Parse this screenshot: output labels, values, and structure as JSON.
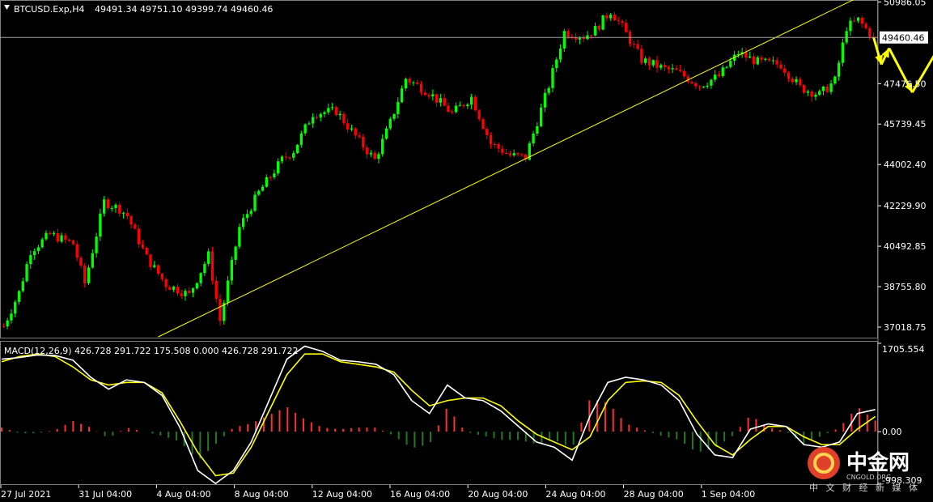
{
  "header": {
    "symbol_label": "BTCUSD.Exp,H4",
    "ohlc_label": "49491.34 49751.10 49399.74 49460.46"
  },
  "current_price_label": "49460.46",
  "macd_label": "MACD(12,26,9) 426.728 291.722 175.508 0.000 426.728 291.722",
  "watermark": {
    "cn": "中金网",
    "en": "CNGOLD.ORG",
    "sub": "中 文 财 经 新 媒 体"
  },
  "colors": {
    "background": "#000000",
    "bull": "#00ff00",
    "bear": "#ff0000",
    "trendline": "#ffff00",
    "forecast": "#ffff00",
    "macd_line": "#ffffff",
    "signal_line": "#ffff00",
    "hist_pos": "#ff3030",
    "hist_neg": "#1f7a1f",
    "grid_text": "#ffffff"
  },
  "chart_data": [
    {
      "type": "candlestick",
      "title": "BTCUSD.Exp,H4",
      "y_ticks": [
        "50986.05",
        "47476.50",
        "45739.45",
        "44002.40",
        "42229.90",
        "40492.85",
        "38755.80",
        "37018.75"
      ],
      "x_ticks": [
        "27 Jul 2021",
        "31 Jul 04:00",
        "4 Aug 04:00",
        "8 Aug 04:00",
        "12 Aug 04:00",
        "16 Aug 04:00",
        "20 Aug 04:00",
        "24 Aug 04:00",
        "28 Aug 04:00",
        "1 Sep 04:00"
      ],
      "ylim": [
        36600,
        51000
      ],
      "n_bars": 226,
      "current_price": 49460.46,
      "path_anchors": [
        [
          0,
          37050
        ],
        [
          4,
          38500
        ],
        [
          7,
          40300
        ],
        [
          12,
          41000
        ],
        [
          18,
          40600
        ],
        [
          21,
          38900
        ],
        [
          26,
          42400
        ],
        [
          30,
          42100
        ],
        [
          32,
          41800
        ],
        [
          37,
          40000
        ],
        [
          42,
          38850
        ],
        [
          48,
          38400
        ],
        [
          53,
          40100
        ],
        [
          56,
          37300
        ],
        [
          61,
          41300
        ],
        [
          66,
          42800
        ],
        [
          72,
          44200
        ],
        [
          75,
          44600
        ],
        [
          80,
          46200
        ],
        [
          86,
          46300
        ],
        [
          92,
          45000
        ],
        [
          96,
          44200
        ],
        [
          100,
          45800
        ],
        [
          104,
          47700
        ],
        [
          110,
          47100
        ],
        [
          116,
          46200
        ],
        [
          121,
          46900
        ],
        [
          126,
          44900
        ],
        [
          131,
          44400
        ],
        [
          135,
          44300
        ],
        [
          141,
          47400
        ],
        [
          145,
          49700
        ],
        [
          150,
          49500
        ],
        [
          153,
          49800
        ],
        [
          157,
          50600
        ],
        [
          160,
          49900
        ],
        [
          165,
          48500
        ],
        [
          171,
          48100
        ],
        [
          174,
          48000
        ],
        [
          180,
          47400
        ],
        [
          185,
          47800
        ],
        [
          190,
          48800
        ],
        [
          195,
          48400
        ],
        [
          201,
          48300
        ],
        [
          206,
          47300
        ],
        [
          211,
          47000
        ],
        [
          215,
          47600
        ],
        [
          218,
          49900
        ],
        [
          221,
          50200
        ],
        [
          225,
          49460
        ]
      ],
      "trendline": {
        "start": [
          40,
          36600
        ],
        "end": [
          220,
          51100
        ]
      },
      "forecast_path": [
        [
          49460,
          0
        ],
        [
          48300,
          2
        ],
        [
          49000,
          4
        ],
        [
          47100,
          10
        ],
        [
          49900,
          20
        ],
        [
          46800,
          31
        ]
      ]
    },
    {
      "type": "line+bar",
      "title": "MACD(12,26,9)",
      "series": [
        {
          "name": "MACD",
          "values": [
            1400,
            1430,
            1480,
            1470,
            1380,
            1050,
            820,
            1000,
            950,
            700,
            80,
            -750,
            -1000,
            -750,
            -200,
            600,
            1400,
            1650,
            1550,
            1380,
            1350,
            1300,
            1100,
            600,
            350,
            900,
            650,
            600,
            400,
            100,
            -200,
            -300,
            -550,
            300,
            950,
            1050,
            1000,
            900,
            600,
            -50,
            -450,
            -500,
            50,
            150,
            100,
            -250,
            -300,
            -200,
            350,
            426.728
          ]
        },
        {
          "name": "Signal",
          "values": [
            1350,
            1450,
            1500,
            1450,
            1250,
            1000,
            900,
            950,
            950,
            750,
            200,
            -400,
            -850,
            -800,
            -300,
            400,
            1100,
            1500,
            1500,
            1350,
            1300,
            1250,
            1150,
            800,
            500,
            600,
            650,
            650,
            500,
            200,
            -50,
            -200,
            -350,
            -100,
            600,
            950,
            980,
            950,
            700,
            200,
            -250,
            -450,
            -150,
            100,
            100,
            -100,
            -250,
            -250,
            50,
            291.722
          ]
        }
      ],
      "histogram_value": 175.508,
      "y_ticks": [
        "1705.554",
        "0.00",
        "-998.309"
      ],
      "ylim": [
        -998.309,
        1705.554
      ]
    }
  ]
}
